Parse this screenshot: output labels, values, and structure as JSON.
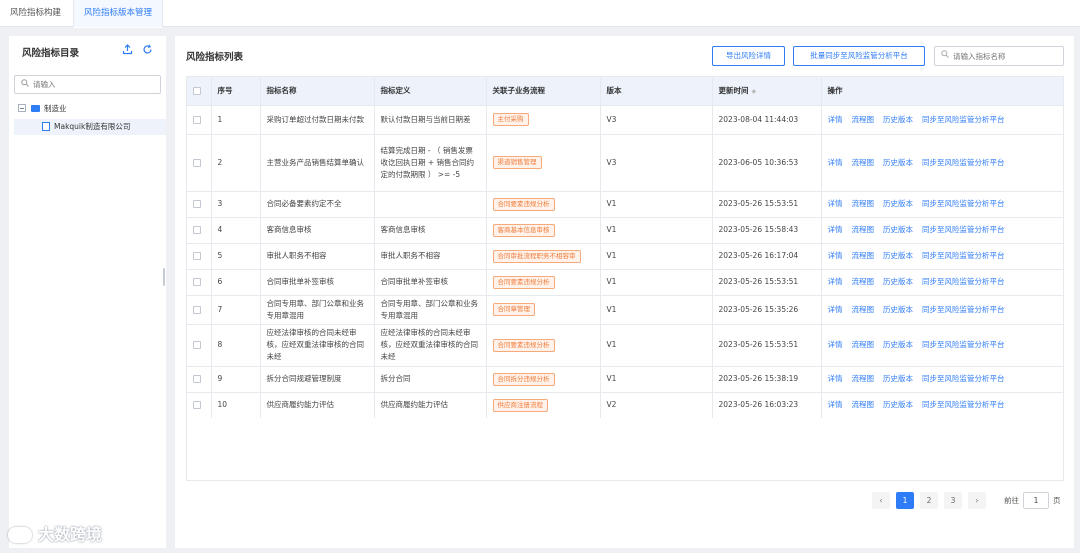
{
  "tabs": [
    "风险指标构建",
    "风险指标版本管理"
  ],
  "sidebar": {
    "title": "风险指标目录",
    "search_placeholder": "请输入",
    "tree": {
      "root": "制造业",
      "child": "Makquik制造有限公司"
    }
  },
  "main": {
    "title": "风险指标列表",
    "export_button": "导出风险详情",
    "sync_button": "批量同步至风险监管分析平台",
    "search_placeholder": "请输入指标名称",
    "columns": [
      "序号",
      "指标名称",
      "指标定义",
      "关联子业务流程",
      "版本",
      "更新时间",
      "操作"
    ],
    "actions": [
      "详情",
      "流程图",
      "历史版本",
      "同步至风险监管分析平台"
    ],
    "rows": [
      {
        "no": "1",
        "name": "采购订单超过付款日期未付款",
        "def": "默认付款日期与当前日期差",
        "process": "主付采购",
        "version": "V3",
        "time": "2023-08-04 11:44:03"
      },
      {
        "no": "2",
        "name": "主营业务产品销售结算单确认",
        "def": "结算完成日期 - （ 销售发票收讫回执日期 + 销售合同约定的付款期限 ） >= -5",
        "process": "渠道销售管理",
        "version": "V3",
        "time": "2023-06-05 10:36:53"
      },
      {
        "no": "3",
        "name": "合同必备要素约定不全",
        "def": "",
        "process": "合同要素违规分析",
        "version": "V1",
        "time": "2023-05-26 15:53:51"
      },
      {
        "no": "4",
        "name": "客商信息审核",
        "def": "客商信息审核",
        "process": "客商基本信息审核",
        "version": "V1",
        "time": "2023-05-26 15:58:43"
      },
      {
        "no": "5",
        "name": "审批人职务不相容",
        "def": "审批人职务不相容",
        "process": "合同审批流程职务不相容审",
        "version": "V1",
        "time": "2023-05-26 16:17:04"
      },
      {
        "no": "6",
        "name": "合同审批单补签审核",
        "def": "合同审批单补签审核",
        "process": "合同要素违规分析",
        "version": "V1",
        "time": "2023-05-26 15:53:51"
      },
      {
        "no": "7",
        "name": "合同专用章、部门公章和业务专用章混用",
        "def": "合同专用章、部门公章和业务专用章混用",
        "process": "合同章管理",
        "version": "V1",
        "time": "2023-05-26 15:35:26"
      },
      {
        "no": "8",
        "name": "应经法律审核的合同未经审核，应经双重法律审核的合同未经",
        "def": "应经法律审核的合同未经审核，应经双重法律审核的合同未经",
        "process": "合同要素违规分析",
        "version": "V1",
        "time": "2023-05-26 15:53:51"
      },
      {
        "no": "9",
        "name": "拆分合同规避管理制度",
        "def": "拆分合同",
        "process": "合同拆分违规分析",
        "version": "V1",
        "time": "2023-05-26 15:38:19"
      },
      {
        "no": "10",
        "name": "供应商履约能力评估",
        "def": "供应商履约能力评估",
        "process": "供应商注册流程",
        "version": "V2",
        "time": "2023-05-26 16:03:23"
      }
    ]
  },
  "pagination": {
    "pages": [
      "1",
      "2",
      "3"
    ],
    "current": "1",
    "prev": "‹",
    "next": "›",
    "goto_label": "前往",
    "goto_value": "1",
    "page_suffix": "页"
  },
  "watermark": "大数跨境",
  "colors": {
    "accent": "#2f7df6",
    "tag_border": "#f6a97a",
    "tag_bg": "#fff2ea",
    "tag_text": "#f07d3c"
  },
  "icons": {
    "upload": "upload-icon",
    "refresh": "refresh-icon",
    "search": "search-icon"
  }
}
